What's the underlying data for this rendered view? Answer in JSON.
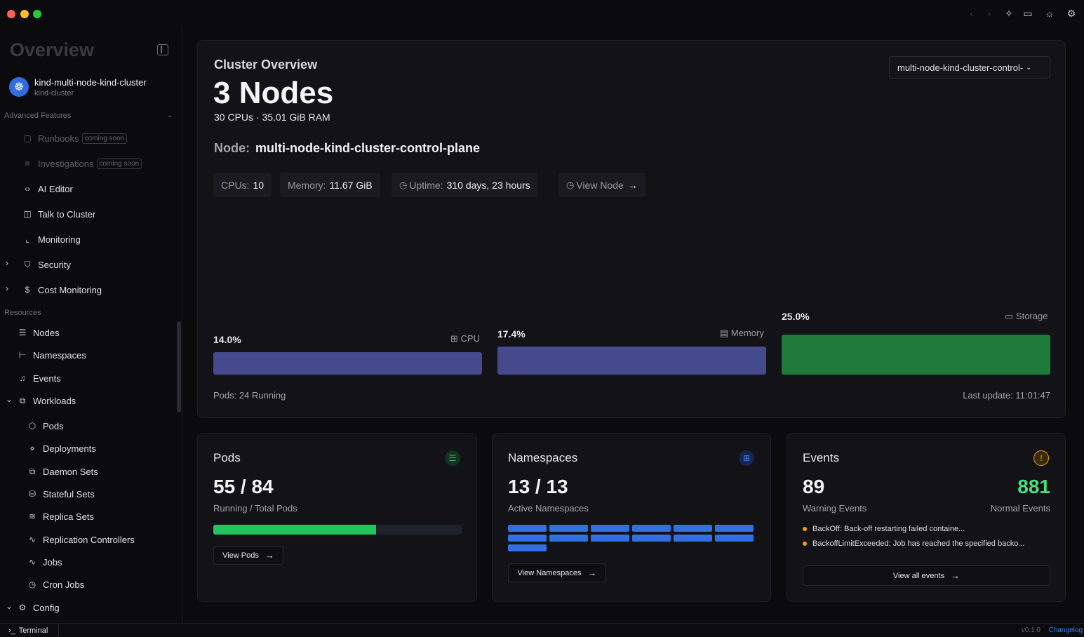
{
  "titlebar": {
    "icons": [
      "chevron-left-icon",
      "chevron-right-icon",
      "sparkle-icon",
      "monitor-icon",
      "sun-icon",
      "gear-icon"
    ]
  },
  "sidebar": {
    "title": "Overview",
    "cluster_name": "kind-multi-node-kind-cluster",
    "cluster_sub": "kind-cluster",
    "section_advanced": "Advanced Features",
    "section_resources": "Resources",
    "badge": "coming soon",
    "items": {
      "runbooks": "Runbooks",
      "investigations": "Investigations",
      "ai_editor": "AI Editor",
      "talk": "Talk to Cluster",
      "monitoring": "Monitoring",
      "security": "Security",
      "cost": "Cost Monitoring",
      "nodes": "Nodes",
      "namespaces": "Namespaces",
      "events": "Events",
      "workloads": "Workloads",
      "pods": "Pods",
      "deployments": "Deployments",
      "daemonsets": "Daemon Sets",
      "statefulsets": "Stateful Sets",
      "replicasets": "Replica Sets",
      "replication": "Replication Controllers",
      "jobs": "Jobs",
      "cronjobs": "Cron Jobs",
      "config": "Config"
    }
  },
  "overview": {
    "label": "Cluster Overview",
    "nodes": "3 Nodes",
    "sub": "30 CPUs · 35.01 GiB RAM",
    "select_value": "multi-node-kind-cluster-control-",
    "node_key": "Node:",
    "node_value": "multi-node-kind-cluster-control-plane",
    "chips": {
      "cpu_k": "CPUs:",
      "cpu_v": "10",
      "mem_k": "Memory:",
      "mem_v": "11.67 GiB",
      "up_k": "Uptime:",
      "up_v": "310 days, 23 hours",
      "view": "View Node"
    },
    "metrics": {
      "cpu": {
        "pct": "14.0%",
        "label": "CPU",
        "value": 14.0,
        "color": "#444a8c"
      },
      "memory": {
        "pct": "17.4%",
        "label": "Memory",
        "value": 17.4,
        "color": "#444a8c"
      },
      "storage": {
        "pct": "25.0%",
        "label": "Storage",
        "value": 25.0,
        "color": "#1d7a3a"
      }
    },
    "pods_running": "Pods: 24 Running",
    "last_update": "Last update: 11:01:47"
  },
  "pods_card": {
    "title": "Pods",
    "big": "55 / 84",
    "caption": "Running / Total Pods",
    "running": 55,
    "total": 84,
    "bar_color": "#22c55e",
    "button": "View Pods"
  },
  "ns_card": {
    "title": "Namespaces",
    "big": "13 / 13",
    "caption": "Active Namespaces",
    "count": 13,
    "button": "View Namespaces"
  },
  "events_card": {
    "title": "Events",
    "warning_count": "89",
    "warning_label": "Warning Events",
    "normal_count": "881",
    "normal_label": "Normal Events",
    "items": [
      "BackOff: Back-off restarting failed containe...",
      "BackoffLimitExceeded: Job has reached the specified backo..."
    ],
    "button": "View all events"
  },
  "bottombar": {
    "terminal": "Terminal",
    "version": "v0.1.0",
    "changelog": "Changelog"
  }
}
